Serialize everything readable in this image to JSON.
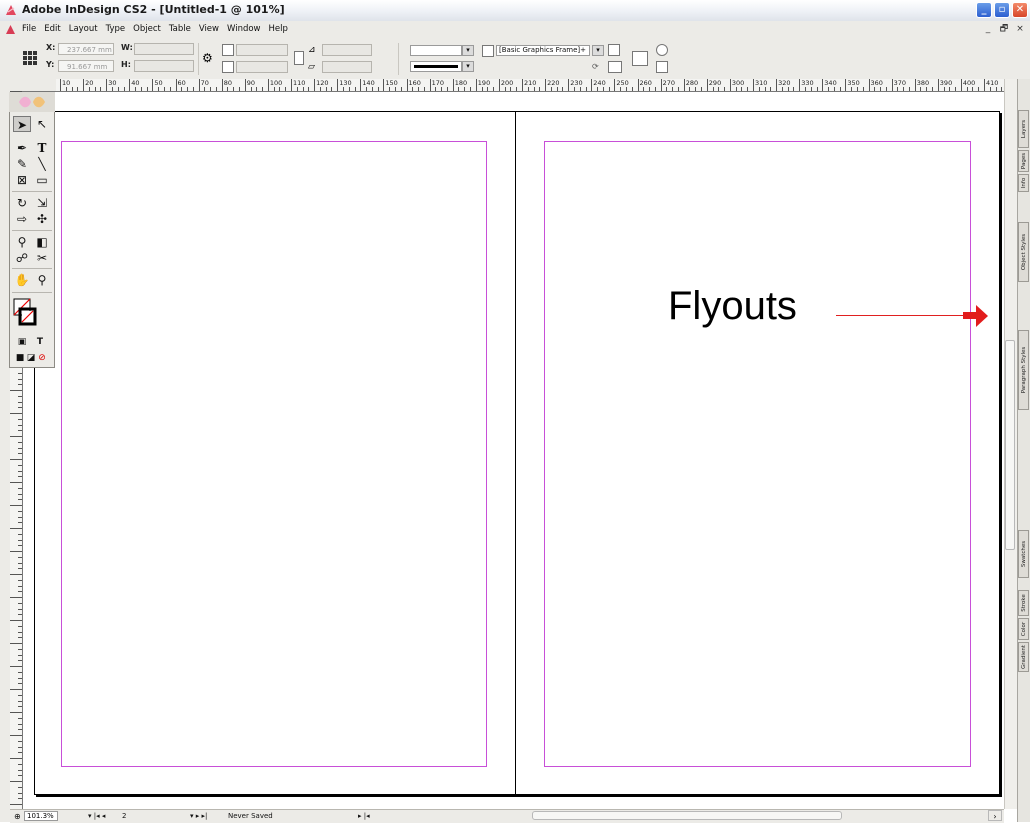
{
  "window": {
    "title": "Adobe InDesign CS2 - [Untitled-1 @ 101%]",
    "minimize_icon": "minimize-icon",
    "maximize_icon": "restore-icon",
    "close_icon": "close-icon"
  },
  "menu": {
    "items": [
      "File",
      "Edit",
      "Layout",
      "Type",
      "Object",
      "Table",
      "View",
      "Window",
      "Help"
    ],
    "doc_controls": [
      "_",
      "🗗",
      "×"
    ]
  },
  "control_panel": {
    "x_label": "X:",
    "x_value": "237.667 mm",
    "y_label": "Y:",
    "y_value": "91.667 mm",
    "w_label": "W:",
    "h_label": "H:",
    "object_style": "[Basic Graphics Frame]+"
  },
  "ruler": {
    "labels": [
      "10",
      "20",
      "30",
      "40",
      "50",
      "60",
      "70",
      "80",
      "90",
      "100",
      "110",
      "120",
      "130",
      "140",
      "150",
      "160",
      "170",
      "180",
      "190",
      "200",
      "210",
      "220",
      "230",
      "240",
      "250",
      "260",
      "270",
      "280",
      "290",
      "300",
      "310",
      "320",
      "330",
      "340",
      "350",
      "360",
      "370",
      "380",
      "390",
      "400",
      "410"
    ]
  },
  "annotation": {
    "text": "Flyouts",
    "arrow_color": "#e21c1c"
  },
  "colors": {
    "margin_guide": "#c84fd8"
  },
  "right_tabs": [
    "Layers",
    "Pages",
    "Info",
    "Object Styles",
    "Paragraph Styles",
    "Swatches",
    "Stroke",
    "Color",
    "Gradient"
  ],
  "status_bar": {
    "zoom": "101.3%",
    "page": "2",
    "save_status": "Never Saved"
  }
}
